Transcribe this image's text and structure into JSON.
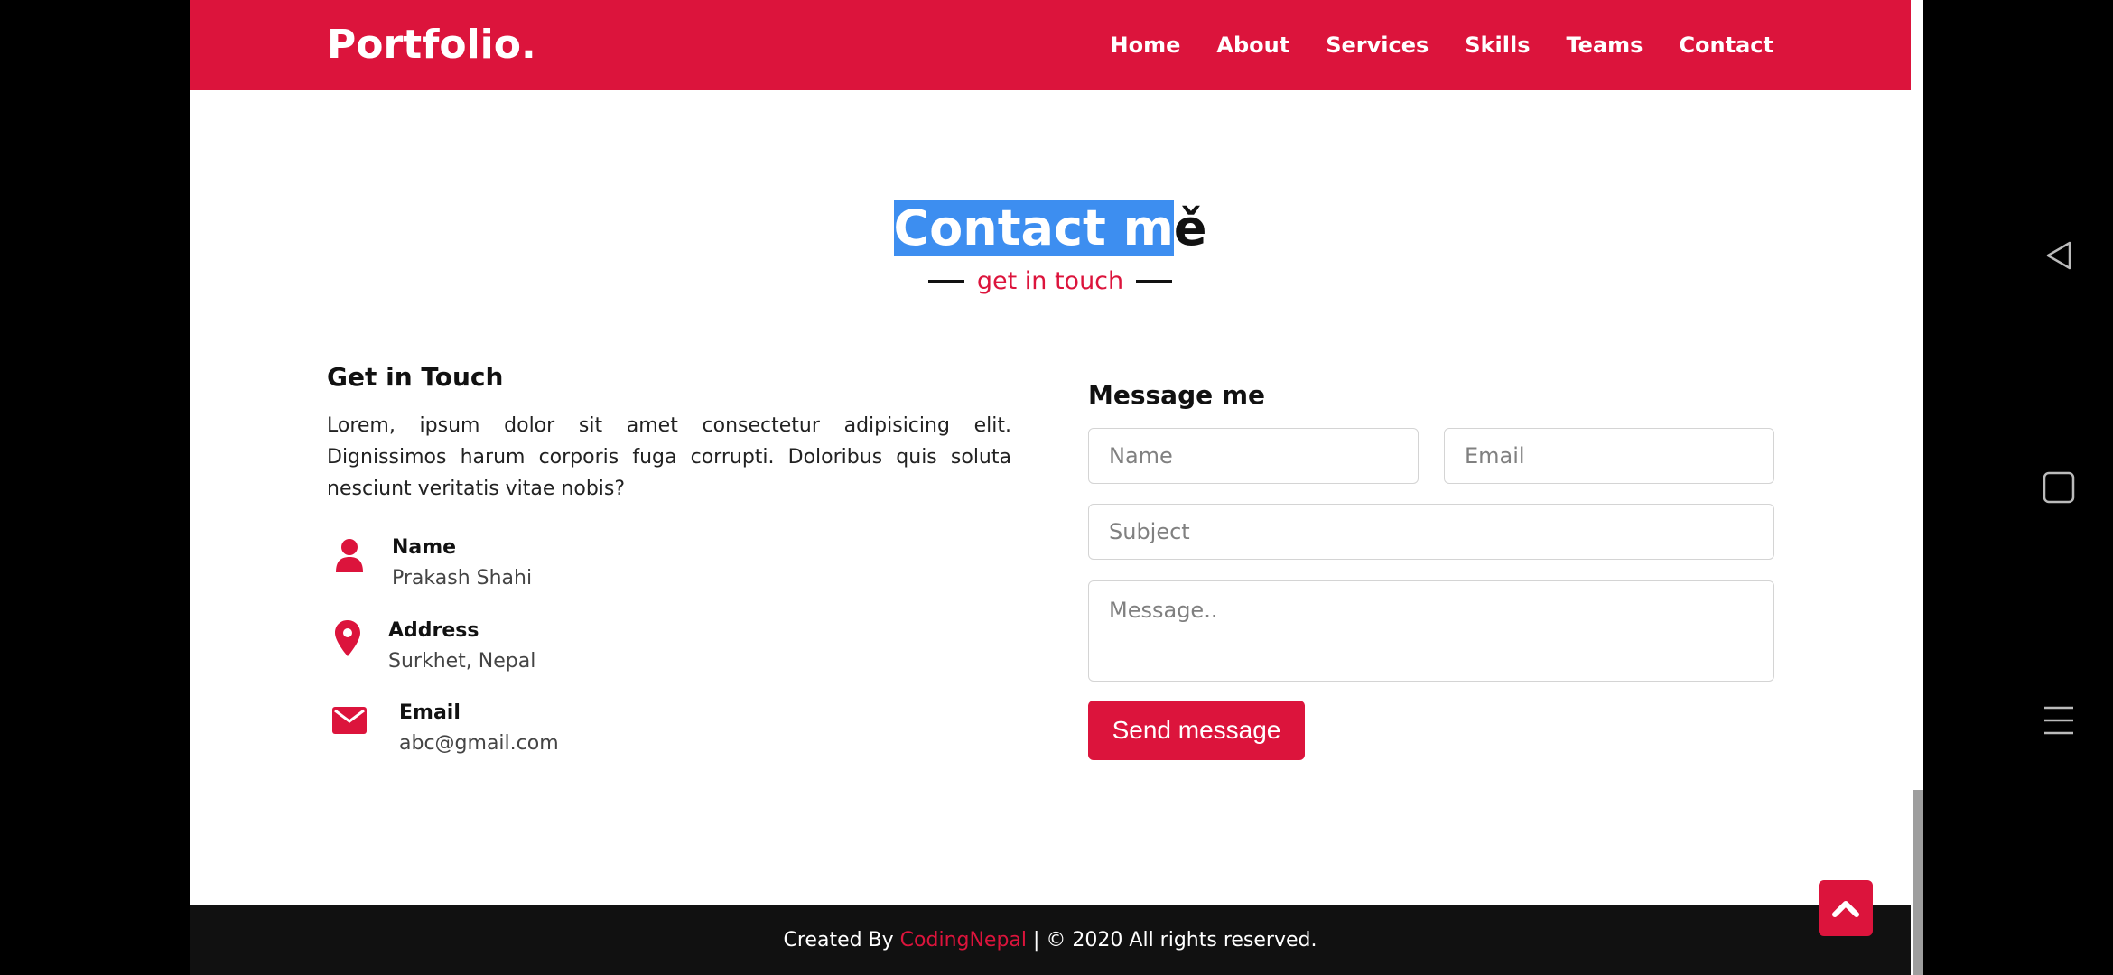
{
  "navbar": {
    "logo": "Portfolio.",
    "menu": [
      "Home",
      "About",
      "Services",
      "Skills",
      "Teams",
      "Contact"
    ]
  },
  "section": {
    "title_highlighted": "Contact m",
    "title_rest": "ě",
    "subtitle": "get in touch"
  },
  "get_in_touch": {
    "heading": "Get in Touch",
    "text": "Lorem, ipsum dolor sit amet consectetur adipisicing elit. Dignissimos harum corporis fuga corrupti. Doloribus quis soluta nesciunt veritatis vitae nobis?",
    "items": [
      {
        "label": "Name",
        "value": "Prakash Shahi",
        "icon": "user-icon"
      },
      {
        "label": "Address",
        "value": "Surkhet, Nepal",
        "icon": "map-marker-icon"
      },
      {
        "label": "Email",
        "value": "abc@gmail.com",
        "icon": "envelope-icon"
      }
    ]
  },
  "message_form": {
    "heading": "Message me",
    "name_placeholder": "Name",
    "email_placeholder": "Email",
    "subject_placeholder": "Subject",
    "message_placeholder": "Message..",
    "send_label": "Send message"
  },
  "footer": {
    "prefix": "Created By ",
    "brand": "CodingNepal",
    "suffix": " | © 2020 All rights reserved."
  },
  "colors": {
    "accent": "#dc143c",
    "footer_bg": "#111111",
    "highlight": "#3d8ef0"
  }
}
